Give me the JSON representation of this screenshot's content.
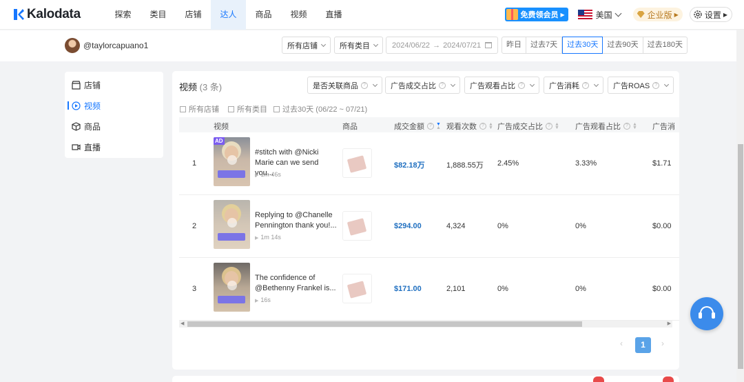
{
  "brand": {
    "name": "Kalodata"
  },
  "nav": {
    "items": [
      {
        "label": "探索",
        "active": false
      },
      {
        "label": "类目",
        "active": false
      },
      {
        "label": "店铺",
        "active": false
      },
      {
        "label": "达人",
        "active": true
      },
      {
        "label": "商品",
        "active": false
      },
      {
        "label": "视频",
        "active": false
      },
      {
        "label": "直播",
        "active": false
      }
    ],
    "vip_button": "免费领会员",
    "region": "美国",
    "enterprise": "企业版",
    "settings": "设置"
  },
  "creator": {
    "handle": "@taylorcapuano1",
    "shop_filter": "所有店铺",
    "category_filter": "所有类目",
    "date_start": "2024/06/22",
    "date_sep": "→",
    "date_end": "2024/07/21",
    "ranges": [
      "昨日",
      "过去7天",
      "过去30天",
      "过去90天",
      "过去180天"
    ],
    "active_range": "过去30天"
  },
  "sidebar": {
    "items": [
      {
        "label": "店铺",
        "icon": "store-icon"
      },
      {
        "label": "视频",
        "icon": "video-play-icon"
      },
      {
        "label": "商品",
        "icon": "box-icon"
      },
      {
        "label": "直播",
        "icon": "live-camera-icon"
      }
    ],
    "active": "视频"
  },
  "panel": {
    "title": "视频",
    "count": "(3 条)",
    "filters": [
      "是否关联商品",
      "广告成交占比",
      "广告观看占比",
      "广告消耗",
      "广告ROAS"
    ],
    "meta": {
      "shop": "所有店铺",
      "category": "所有类目",
      "period": "过去30天 (06/22 ~ 07/21)"
    }
  },
  "table": {
    "headers": {
      "video": "视频",
      "product": "商品",
      "gmv": "成交金额",
      "views": "观看次数",
      "ad_gmv_ratio": "广告成交占比",
      "ad_view_ratio": "广告观看占比",
      "ad_spend": "广告消"
    },
    "rows": [
      {
        "rank": "1",
        "ad": "AD",
        "title": "#stitch with @Nicki Marie can we send you...",
        "duration": "1m 46s",
        "gmv": "$82.18万",
        "views": "1,888.55万",
        "ad_gmv_ratio": "2.45%",
        "ad_view_ratio": "3.33%",
        "ad_spend": "$1.71"
      },
      {
        "rank": "2",
        "ad": "",
        "title": "Replying to @Chanelle Pennington thank you!...",
        "duration": "1m 14s",
        "gmv": "$294.00",
        "views": "4,324",
        "ad_gmv_ratio": "0%",
        "ad_view_ratio": "0%",
        "ad_spend": "$0.00"
      },
      {
        "rank": "3",
        "ad": "",
        "title": "The confidence of @Bethenny Frankel is...",
        "duration": "16s",
        "gmv": "$171.00",
        "views": "2,101",
        "ad_gmv_ratio": "0%",
        "ad_view_ratio": "0%",
        "ad_spend": "$0.00"
      }
    ]
  },
  "pagination": {
    "prev": "‹",
    "current": "1",
    "next": "›"
  },
  "colors": {
    "accent": "#1677ff",
    "gmv": "#1f6fc0",
    "nav_active_bg": "#e8f1fb",
    "chat": "#3b8beb"
  }
}
